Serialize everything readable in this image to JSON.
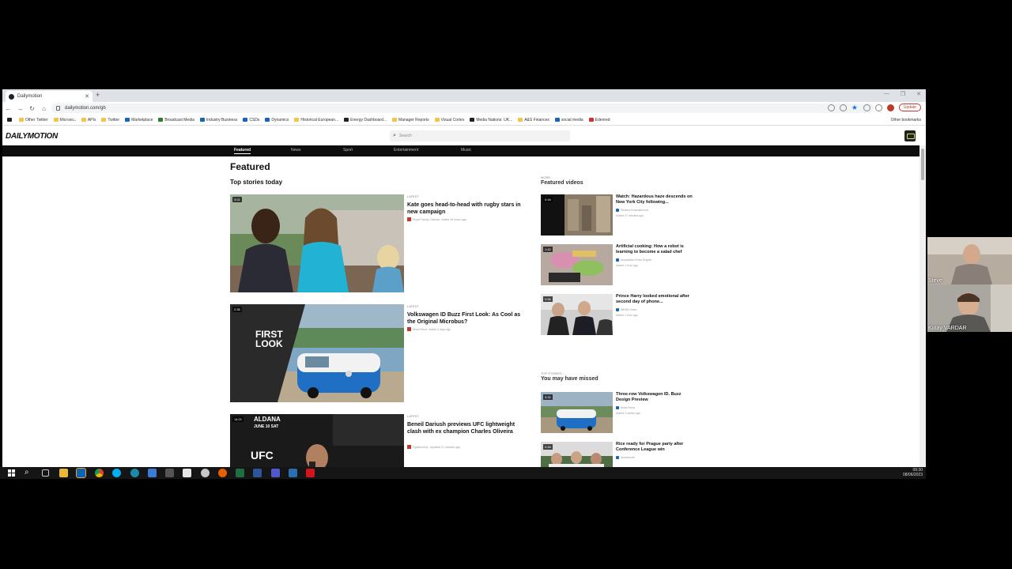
{
  "browser": {
    "tab_title": "Dailymotion",
    "tab_close": "✕",
    "new_tab": "+",
    "window_controls": [
      "—",
      "❐",
      "✕"
    ],
    "url": "dailymotion.com/gb",
    "update_label": "Update",
    "bookmarks": [
      {
        "label": "",
        "icon": "dark"
      },
      {
        "label": "Other Twitter",
        "icon": "folder"
      },
      {
        "label": "Microsoft",
        "icon": "folder"
      },
      {
        "label": "APIs",
        "icon": "folder"
      },
      {
        "label": "Twitter",
        "icon": "folder"
      },
      {
        "label": "Marketplace",
        "icon": "blue"
      },
      {
        "label": "Broadcast Media",
        "icon": "green"
      },
      {
        "label": "Industry Business",
        "icon": "blue"
      },
      {
        "label": "CSDs",
        "icon": "blue"
      },
      {
        "label": "Dynamics",
        "icon": "blue"
      },
      {
        "label": "Historical European...",
        "icon": "folder"
      },
      {
        "label": "Energy Dashboard...",
        "icon": "dark"
      },
      {
        "label": "Manager Reports",
        "icon": "folder"
      },
      {
        "label": "Visual Cortex",
        "icon": "folder"
      },
      {
        "label": "Media Nations: UK...",
        "icon": "dark"
      },
      {
        "label": "A&S Finances",
        "icon": "folder"
      },
      {
        "label": "social media",
        "icon": "blue"
      },
      {
        "label": "Edenred",
        "icon": "red"
      }
    ],
    "other_bookmarks": "Other bookmarks"
  },
  "site": {
    "logo": "DAILYMOTION",
    "search_placeholder": "Search",
    "nav": [
      "Featured",
      "News",
      "Sport",
      "Entertainment",
      "Music"
    ]
  },
  "main": {
    "heading": "Featured",
    "subheading": "Top stories today",
    "stories": [
      {
        "duration": "3:01",
        "kicker": "LATEST",
        "title": "Kate goes head-to-head with rugby stars in new campaign",
        "source": "Royal Family Channel",
        "time": "Added 16 hours ago"
      },
      {
        "duration": "2:35",
        "kicker": "LATEST",
        "title": "Volkswagen ID Buzz First Look: As Cool as the Original Microbus?",
        "source": "MotorTrend",
        "time": "Added 3 days ago"
      },
      {
        "duration": "14:21",
        "kicker": "LATEST",
        "title": "Beneil Dariush previews UFC lightweight clash with ex champion Charles Oliveira",
        "source": "FightersOnly",
        "time": "Updated 21 minutes ago"
      }
    ],
    "story2_overlay": "FIRST LOOK",
    "story3_overlay": [
      "ALDANA",
      "JUNE 10 SAT",
      "UFC"
    ]
  },
  "sidebar": {
    "more_label": "MORE",
    "featured_videos": "Featured videos",
    "videos": [
      {
        "duration": "0:16",
        "title": "Watch: Hazardous haze descends on New York City following...",
        "source": "Reuters Entertainment",
        "time": "Added 47 minutes ago"
      },
      {
        "duration": "1:42",
        "title": "Artificial cooking: How a robot is learning to become a salad chef",
        "source": "Associated Press English",
        "time": "Added 1 hour ago"
      },
      {
        "duration": "0:56",
        "title": "Prince Harry looked emotional after second day of phone...",
        "source": "WENN Video",
        "time": "Added 1 hour ago"
      }
    ],
    "topstories_label": "TOP STORIES",
    "missed_heading": "You may have missed",
    "missed": [
      {
        "duration": "3:32",
        "title": "Three-row Volkswagen ID. Buzz Design Preview",
        "source": "MotorTrend",
        "time": "Added 2 weeks ago"
      },
      {
        "duration": "0:48",
        "title": "Rice ready for Prague party after Conference League win",
        "source": "Sportsmole",
        "time": "Added 1 day ago"
      }
    ]
  },
  "taskbar": {
    "time": "09:30",
    "date": "08/06/2023"
  },
  "participants": [
    "Steve",
    "Kutay VARDAR"
  ]
}
